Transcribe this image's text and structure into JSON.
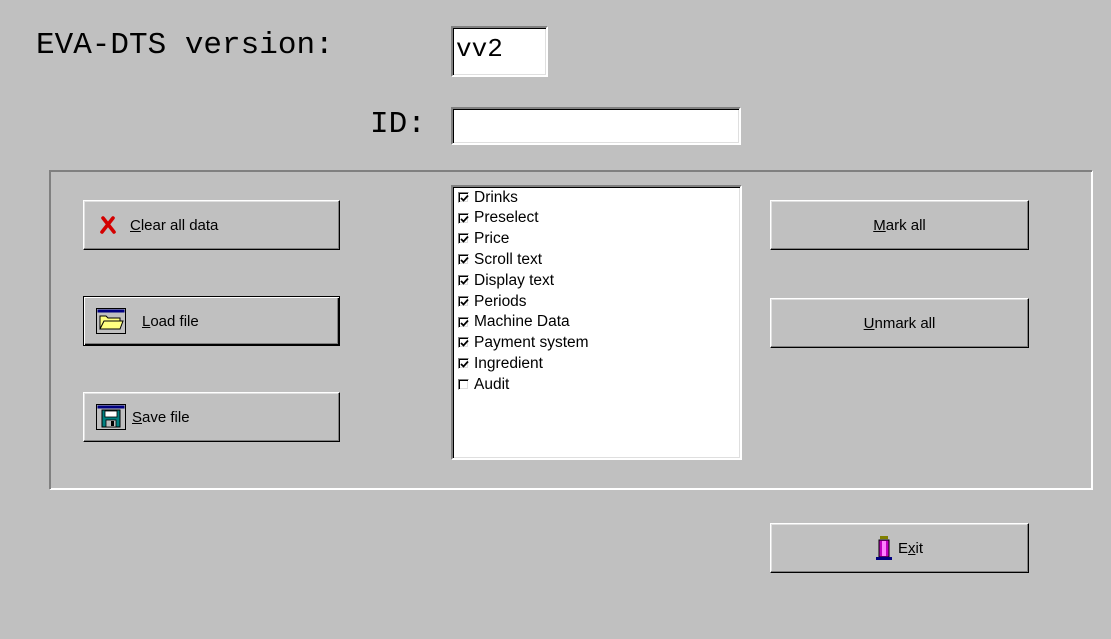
{
  "header": {
    "version_label": "EVA-DTS version:",
    "version_value": "vv2",
    "id_label": "ID:",
    "id_value": ""
  },
  "buttons": {
    "clear": {
      "label": "Clear all data",
      "accelerator": "C",
      "icon": "red-x-icon"
    },
    "load": {
      "label": "Load file",
      "accelerator": "L",
      "icon": "folder-icon"
    },
    "save": {
      "label": "Save file",
      "accelerator": "S",
      "icon": "floppy-disk-icon"
    },
    "mark_all": {
      "label": "Mark all",
      "accelerator": "M"
    },
    "unmark_all": {
      "label": "Unmark all",
      "accelerator": "U"
    },
    "exit": {
      "label": "Exit",
      "accelerator": "x",
      "icon": "exit-door-icon"
    }
  },
  "checklist": [
    {
      "label": "Drinks",
      "checked": true
    },
    {
      "label": "Preselect",
      "checked": true
    },
    {
      "label": "Price",
      "checked": true
    },
    {
      "label": "Scroll text",
      "checked": true
    },
    {
      "label": "Display text",
      "checked": true
    },
    {
      "label": "Periods",
      "checked": true
    },
    {
      "label": "Machine Data",
      "checked": true
    },
    {
      "label": "Payment system",
      "checked": true
    },
    {
      "label": "Ingredient",
      "checked": true
    },
    {
      "label": "Audit",
      "checked": false
    }
  ],
  "colors": {
    "window_bg": "#c0c0c0",
    "clear_icon": "#d40000",
    "folder_icon": "#ffff80",
    "floppy_icon": "#008080",
    "exit_icon": "#c000c0"
  }
}
